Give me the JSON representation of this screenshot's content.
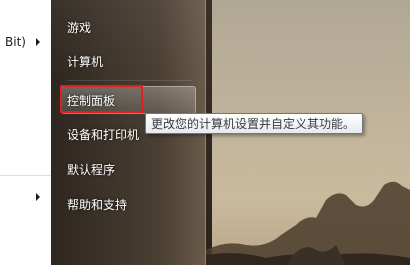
{
  "programs_pane": {
    "item_label": "Bit)"
  },
  "start_menu_right": {
    "items": [
      {
        "label": "游戏"
      },
      {
        "label": "计算机"
      },
      {
        "label": "控制面板"
      },
      {
        "label": "设备和打印机"
      },
      {
        "label": "默认程序"
      },
      {
        "label": "帮助和支持"
      }
    ],
    "hovered_item": "控制面板"
  },
  "tooltip": {
    "text": "更改您的计算机设置并自定义其功能。"
  },
  "colors": {
    "highlight_box": "#e02020",
    "menu_text": "#ffffff",
    "tooltip_border": "#767676"
  }
}
